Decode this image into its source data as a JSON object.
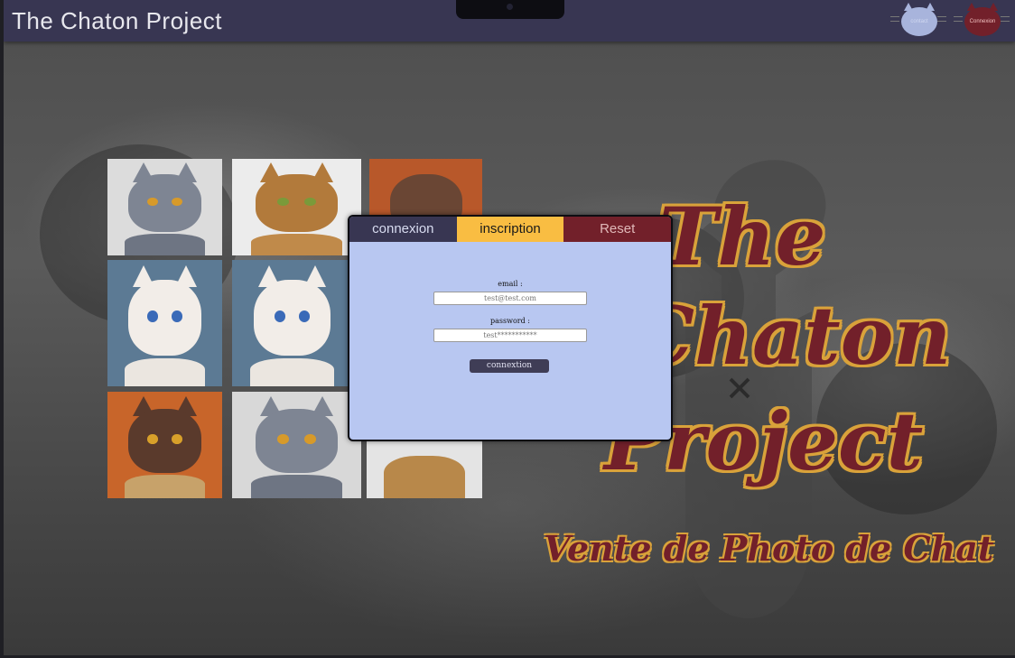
{
  "header": {
    "title": "The Chaton Project",
    "contact_label": "contact",
    "connexion_label": "Connexion"
  },
  "auth_panel": {
    "tabs": [
      {
        "label": "connexion"
      },
      {
        "label": "inscription"
      },
      {
        "label": "Reset"
      }
    ],
    "email_label": "email :",
    "email_placeholder": "test@test.com",
    "password_label": "password :",
    "password_placeholder": "test***********",
    "submit_label": "connextion"
  },
  "hero": {
    "line1": "The",
    "line2": "Chaton",
    "line3": "Project",
    "subtitle": "Vente de Photo de Chat"
  },
  "colors": {
    "header_bg": "#383652",
    "panel_bg": "#b8c7f1",
    "accent_yellow": "#f9bd42",
    "accent_maroon": "#72202a"
  },
  "gallery": {
    "photos": [
      {
        "subject": "grey british shorthair kitten"
      },
      {
        "subject": "bengal kitten"
      },
      {
        "subject": "brown kitten on orange"
      },
      {
        "subject": "white blue-eyed kitten"
      },
      {
        "subject": "white blue-eyed kitten"
      },
      {
        "subject": "brown kitten on basket"
      },
      {
        "subject": "grey british shorthair kitten"
      },
      {
        "subject": "bengal kitten"
      }
    ]
  }
}
